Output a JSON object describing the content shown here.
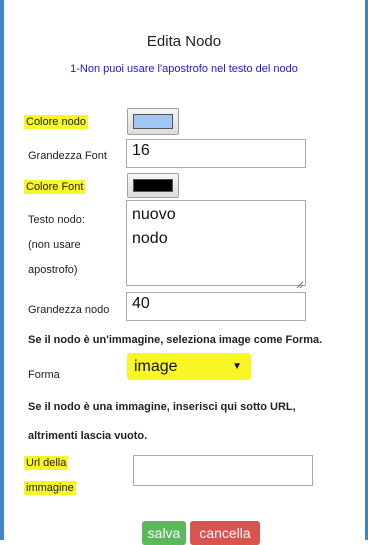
{
  "dialog": {
    "title": "Edita Nodo",
    "note": "1-Non puoi usare l'apostrofo nel testo del nodo"
  },
  "fields": {
    "node_color": {
      "label": "Colore nodo",
      "value": "#9fc8f4"
    },
    "font_size": {
      "label": "Grandezza Font",
      "value": "16"
    },
    "font_color": {
      "label": "Colore Font",
      "value": "#000000"
    },
    "node_text": {
      "label_line1": "Testo nodo:",
      "label_line2": "(non usare",
      "label_line3": "apostrofo)",
      "value": "nuovo\nnodo"
    },
    "node_size": {
      "label": "Grandezza nodo",
      "value": "40"
    },
    "image_hint": "Se il nodo è un'immagine, seleziona image come Forma.",
    "shape": {
      "label": "Forma",
      "value": "image",
      "arrow": "▼"
    },
    "url_hint_line1": "Se il nodo è una immagine, inserisci qui sotto URL,",
    "url_hint_line2": "altrimenti lascia vuoto.",
    "image_url": {
      "label_line1": "Url della",
      "label_line2": "immagine",
      "value": ""
    }
  },
  "buttons": {
    "save": {
      "label": "salva",
      "color": "#5cb85c"
    },
    "cancel": {
      "label": "cancella",
      "color": "#d9534f"
    }
  },
  "colors": {
    "highlight": "#f7f724",
    "frame": "#3f86c9",
    "note_text": "#1a1acb"
  }
}
